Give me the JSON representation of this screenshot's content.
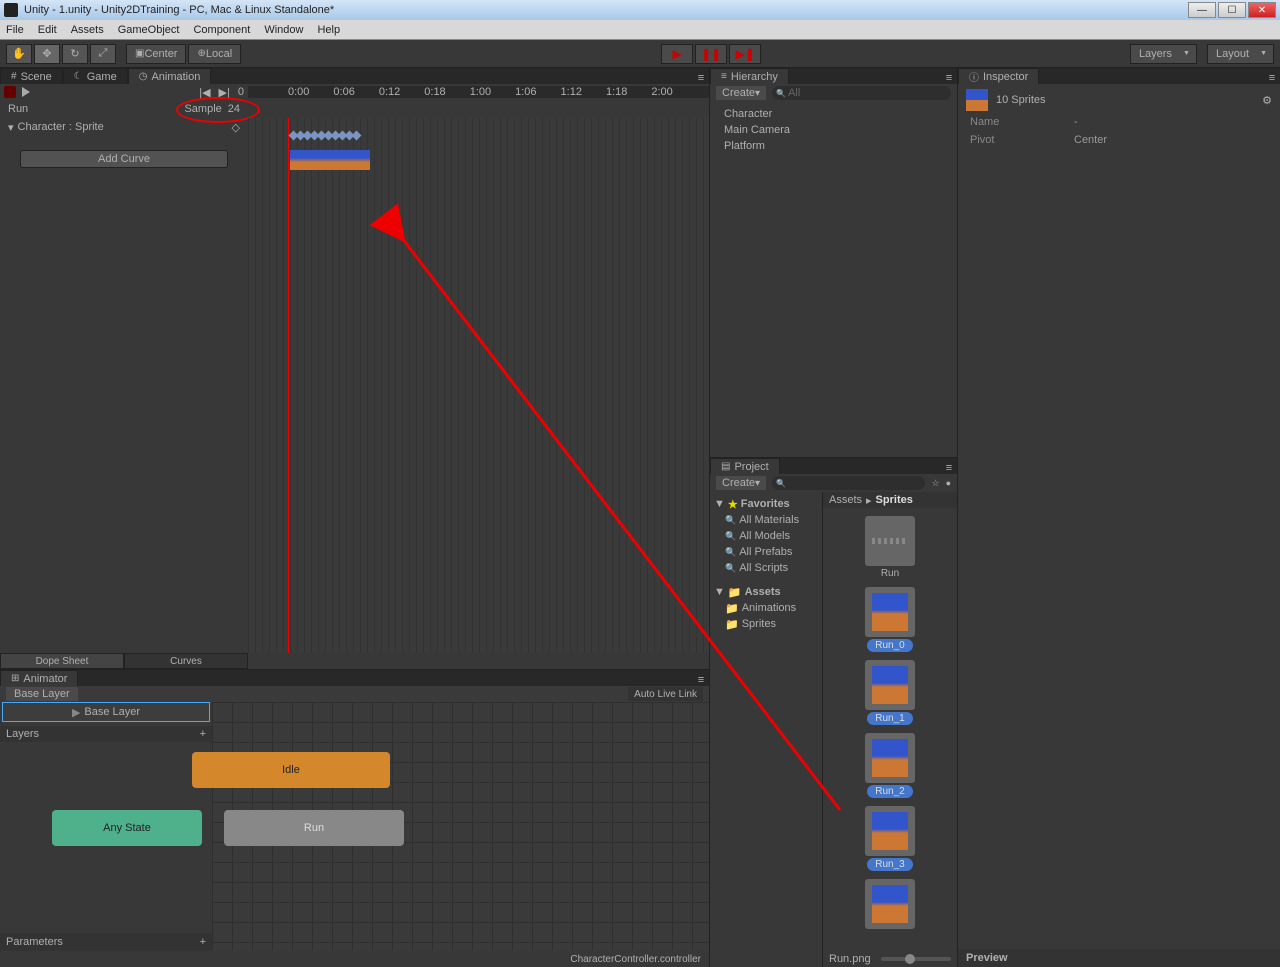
{
  "window": {
    "title": "Unity - 1.unity - Unity2DTraining - PC, Mac & Linux Standalone*"
  },
  "menu": [
    "File",
    "Edit",
    "Assets",
    "GameObject",
    "Component",
    "Window",
    "Help"
  ],
  "toolbar": {
    "center": "Center",
    "local": "Local",
    "layers": "Layers",
    "layout": "Layout"
  },
  "scene_tabs": {
    "scene": "Scene",
    "game": "Game",
    "animation": "Animation"
  },
  "animation": {
    "frame": "0",
    "clip": "Run",
    "sample_label": "Sample",
    "sample_value": "24",
    "property": "Character : Sprite",
    "add_curve": "Add Curve",
    "timecodes": [
      "0:00",
      "0:06",
      "0:12",
      "0:18",
      "1:00",
      "1:06",
      "1:12",
      "1:18",
      "2:00"
    ],
    "footer": {
      "dope": "Dope Sheet",
      "curves": "Curves"
    }
  },
  "animator": {
    "tab": "Animator",
    "base_layer_crumb": "Base Layer",
    "auto_link": "Auto Live Link",
    "base_layer_box": "Base Layer",
    "layers": "Layers",
    "parameters": "Parameters",
    "states": {
      "idle": "Idle",
      "run": "Run",
      "any": "Any State"
    },
    "status": "CharacterController.controller"
  },
  "hierarchy": {
    "tab": "Hierarchy",
    "create": "Create",
    "search_placeholder": "All",
    "items": [
      "Character",
      "Main Camera",
      "Platform"
    ]
  },
  "project": {
    "tab": "Project",
    "create": "Create",
    "favorites": "Favorites",
    "fav_items": [
      "All Materials",
      "All Models",
      "All Prefabs",
      "All Scripts"
    ],
    "assets": "Assets",
    "folders": [
      "Animations",
      "Sprites"
    ],
    "breadcrumb_root": "Assets",
    "breadcrumb_current": "Sprites",
    "run_folder": "Run",
    "sprites": [
      "Run_0",
      "Run_1",
      "Run_2",
      "Run_3"
    ],
    "footer_file": "Run.png"
  },
  "inspector": {
    "tab": "Inspector",
    "title": "10 Sprites",
    "name_lbl": "Name",
    "name_val": "-",
    "pivot_lbl": "Pivot",
    "pivot_val": "Center",
    "preview": "Preview"
  }
}
